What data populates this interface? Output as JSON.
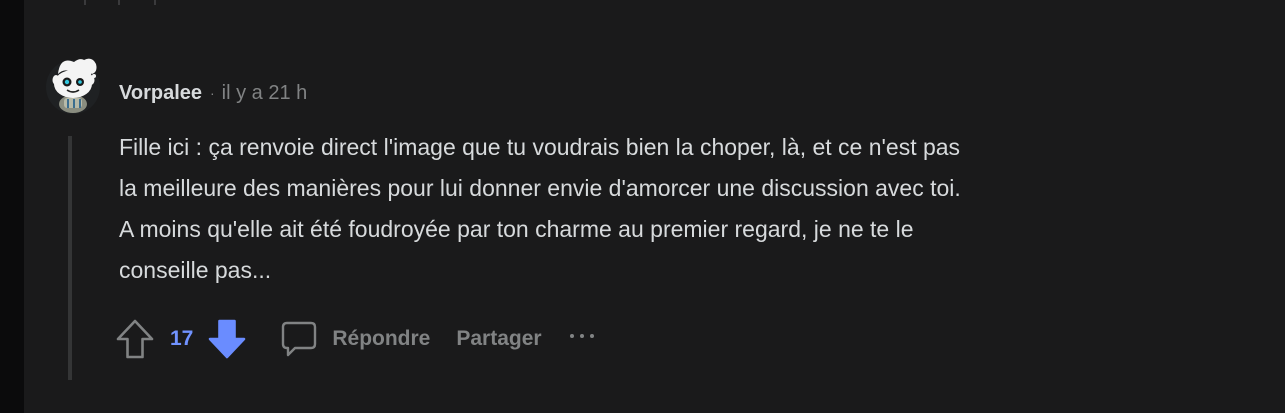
{
  "comment": {
    "author": "Vorpalee",
    "separator": "·",
    "timestamp": "il y a 21 h",
    "body": [
      "Fille ici : ça renvoie direct l'image que tu voudrais bien la choper, là, et ce n'est pas",
      "la meilleure des manières pour lui donner envie d'amorcer une discussion avec toi.",
      "A moins qu'elle ait été foudroyée par ton charme au premier regard, je ne te le",
      "conseille pas..."
    ],
    "vote_count": "17",
    "vote_state": "downvoted",
    "actions": {
      "reply_label": "Répondre",
      "share_label": "Partager"
    }
  },
  "icons": {
    "avatar": "snoo-avatar-icon",
    "upvote": "upvote-arrow-icon",
    "downvote": "downvote-arrow-icon",
    "reply": "comment-bubble-icon",
    "more": "more-dots-icon"
  },
  "colors": {
    "background": "#1a1a1b",
    "text": "#d7dadc",
    "muted": "#818384",
    "vote_active": "#7193ff",
    "downvote_active": "#6a8cff",
    "thread_line": "#343536"
  }
}
